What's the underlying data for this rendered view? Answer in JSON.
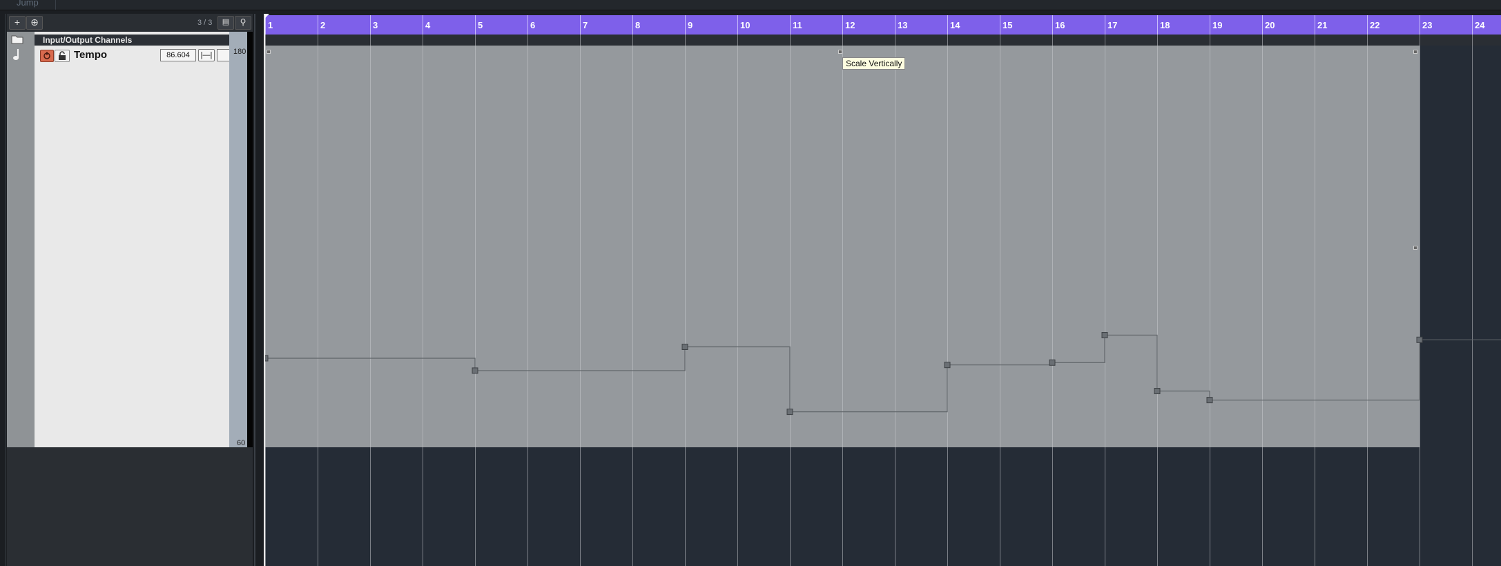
{
  "top_strip": {
    "jump_label": "Jump"
  },
  "toolbar": {
    "add_track_label": "+",
    "add_from_preset_label": "⊕",
    "track_count": "3 / 3"
  },
  "tracks": {
    "folder_label": "Input/Output Channels",
    "tempo": {
      "name": "Tempo",
      "value": "86.604",
      "scale_max": "180",
      "scale_min": "60"
    }
  },
  "ruler": {
    "bars": [
      "1",
      "2",
      "3",
      "4",
      "5",
      "6",
      "7",
      "8",
      "9",
      "10",
      "11",
      "12",
      "13",
      "14",
      "15",
      "16",
      "17",
      "18",
      "19",
      "20",
      "21",
      "22",
      "23",
      "24"
    ]
  },
  "tooltip": {
    "text": "Scale Vertically"
  },
  "colors": {
    "ruler": "#7e60ea",
    "tempo_lane": "#95999d",
    "event_bg": "#252c36",
    "tempo_line": "#5f6468",
    "mute_button": "#d86a4e"
  },
  "tempo_track": {
    "range": [
      60,
      180
    ],
    "points": [
      {
        "bar": 1,
        "bpm": 86.6
      },
      {
        "bar": 5,
        "bpm": 82.9
      },
      {
        "bar": 9,
        "bpm": 90.0
      },
      {
        "bar": 11,
        "bpm": 70.6
      },
      {
        "bar": 14,
        "bpm": 84.6
      },
      {
        "bar": 16,
        "bpm": 85.3
      },
      {
        "bar": 17,
        "bpm": 93.5
      },
      {
        "bar": 18,
        "bpm": 76.8
      },
      {
        "bar": 19,
        "bpm": 74.1
      },
      {
        "bar": 23,
        "bpm": 92.1
      }
    ]
  }
}
